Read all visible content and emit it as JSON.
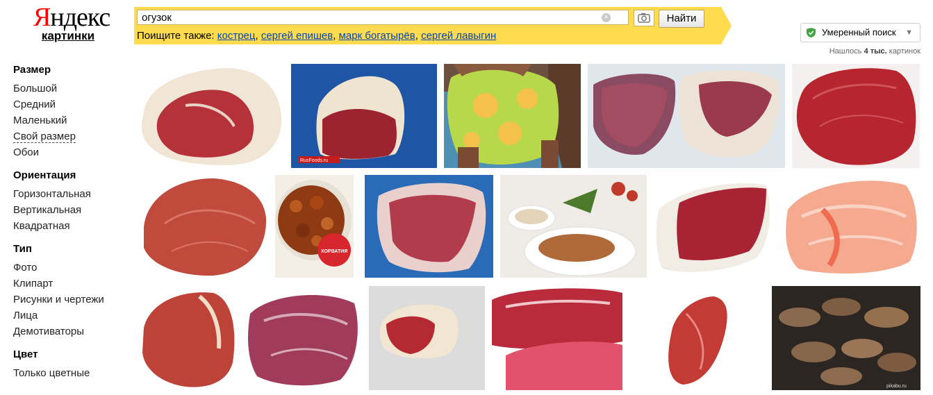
{
  "logo": {
    "main": "Яндекс",
    "sub": "картинки"
  },
  "search": {
    "value": "огузок",
    "button": "Найти",
    "clear": "×"
  },
  "also": {
    "label": "Поищите также:",
    "links": [
      "кострец",
      "сергей епишев",
      "марк богатырёв",
      "сергей лавыгин"
    ]
  },
  "filter": {
    "label": "Умеренный поиск",
    "arrow": "▼"
  },
  "found": {
    "prefix": "Нашлось ",
    "count": "4 тыс.",
    "suffix": " картинок"
  },
  "sidebar": {
    "groups": [
      {
        "title": "Размер",
        "items": [
          "Большой",
          "Средний",
          "Маленький",
          "Свой размер",
          "Обои"
        ]
      },
      {
        "title": "Ориентация",
        "items": [
          "Горизонтальная",
          "Вертикальная",
          "Квадратная"
        ]
      },
      {
        "title": "Тип",
        "items": [
          "Фото",
          "Клипарт",
          "Рисунки и чертежи",
          "Лица",
          "Демотиваторы"
        ]
      },
      {
        "title": "Цвет",
        "items": [
          "Только цветные"
        ]
      }
    ]
  },
  "thumbs": {
    "rusfoods": "RusFoods.ru",
    "horvatia": "ХОРВАТИЯ",
    "pikabu": "pikabu.ru"
  },
  "colors": {
    "accent": "#ffdb4d",
    "link": "#0044bb",
    "logo_red": "#ff0000"
  }
}
